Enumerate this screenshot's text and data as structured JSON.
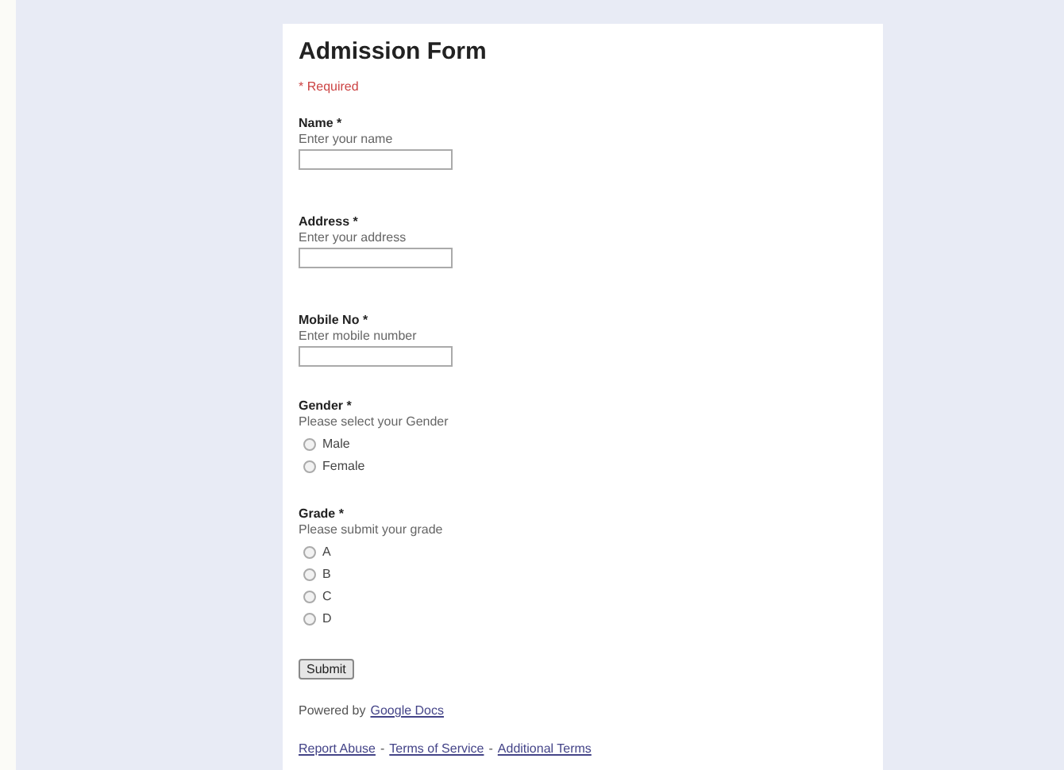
{
  "form": {
    "title": "Admission Form",
    "required_note": "* Required",
    "fields": [
      {
        "kind": "text",
        "label": "Name *",
        "hint": "Enter your name"
      },
      {
        "kind": "text",
        "label": "Address *",
        "hint": "Enter your address"
      },
      {
        "kind": "text",
        "label": "Mobile No *",
        "hint": "Enter mobile number"
      },
      {
        "kind": "radio",
        "label": "Gender *",
        "hint": "Please select your Gender",
        "options": [
          {
            "label": "Male",
            "selected": false
          },
          {
            "label": "Female",
            "selected": false
          }
        ]
      },
      {
        "kind": "radio",
        "label": "Grade *",
        "hint": "Please submit your grade",
        "options": [
          {
            "label": "A",
            "selected": false
          },
          {
            "label": "B",
            "selected": false
          },
          {
            "label": "C",
            "selected": false
          },
          {
            "label": "D",
            "selected": false
          }
        ]
      }
    ],
    "submit": "Submit",
    "powered_by": {
      "text": "Powered by",
      "link": "Google Docs"
    },
    "footer_links": [
      "Report Abuse",
      "Terms of Service",
      "Additional Terms"
    ],
    "footer_separator": "-"
  }
}
